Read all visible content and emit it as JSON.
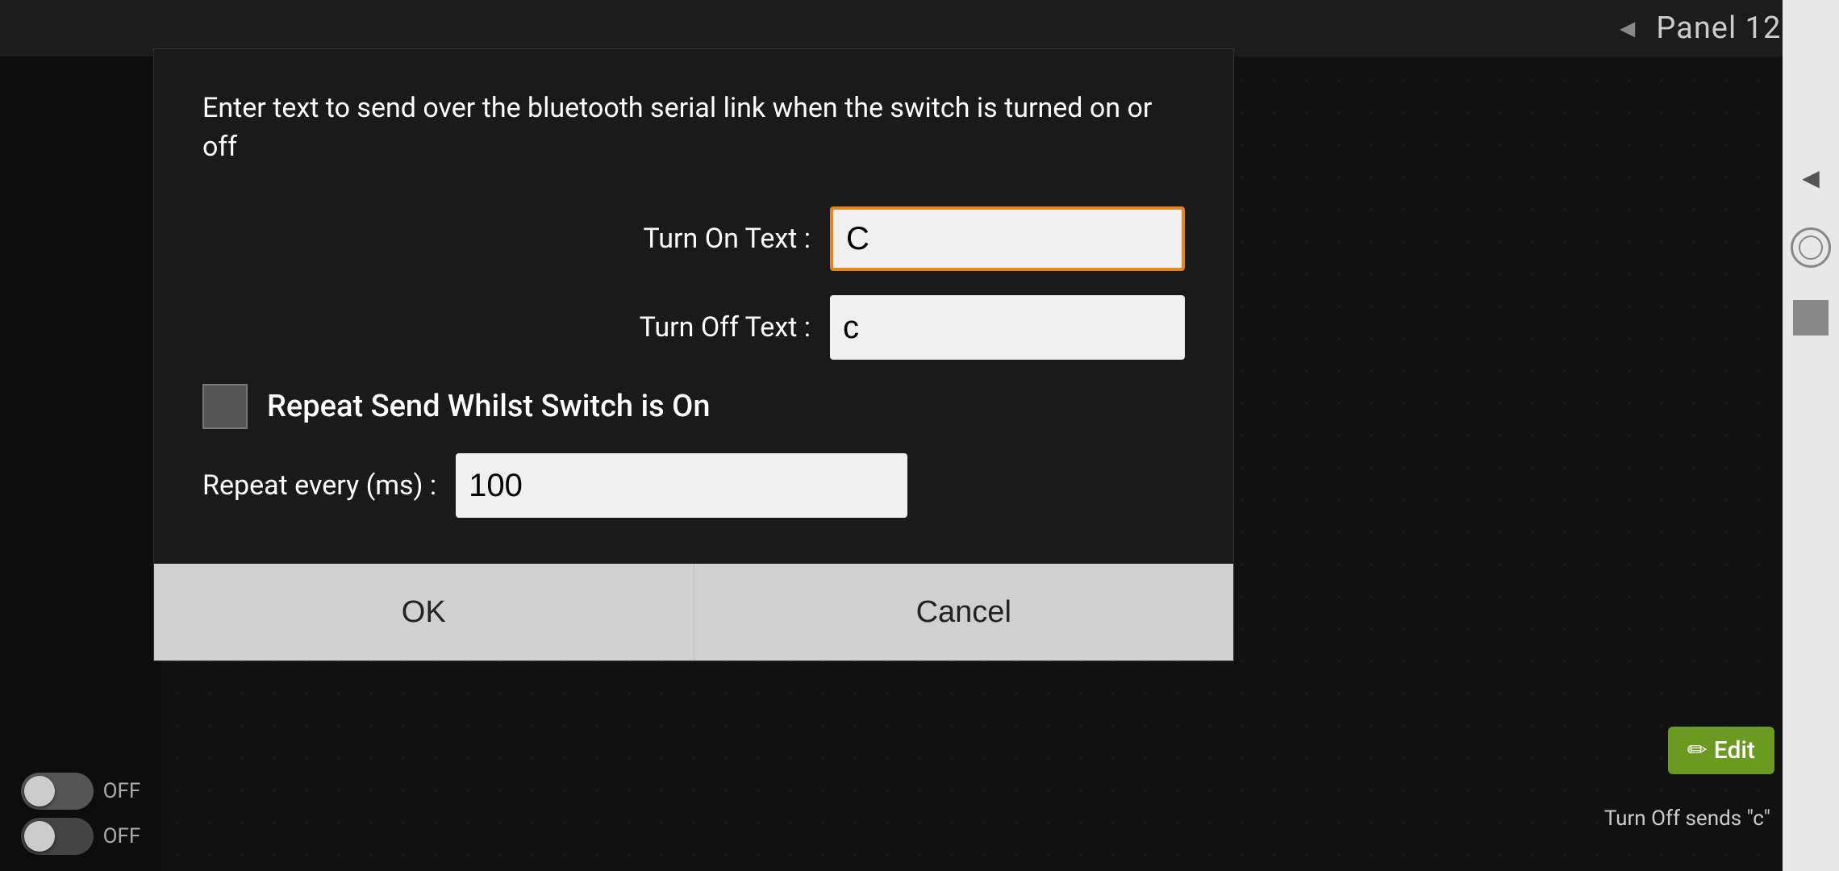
{
  "topbar": {
    "title": "Panel 12",
    "arrow_left": "◄",
    "arrow_right": "►"
  },
  "dialog": {
    "description": "Enter text to send over the bluetooth serial link when the switch is turned on or off",
    "turn_on_label": "Turn On Text :",
    "turn_on_value": "C",
    "turn_off_label": "Turn Off Text :",
    "turn_off_value": "c",
    "checkbox_label": "Repeat Send Whilst Switch is On",
    "repeat_label": "Repeat every (ms) :",
    "repeat_value": "100",
    "ok_label": "OK",
    "cancel_label": "Cancel"
  },
  "bottom_info": {
    "text": "Turn Off sends \"c\""
  },
  "edit_button": {
    "label": "Edit"
  },
  "toggles": [
    {
      "label": "OFF"
    },
    {
      "label": "OFF"
    }
  ],
  "right_sidebar": {
    "arrow": "◄"
  }
}
